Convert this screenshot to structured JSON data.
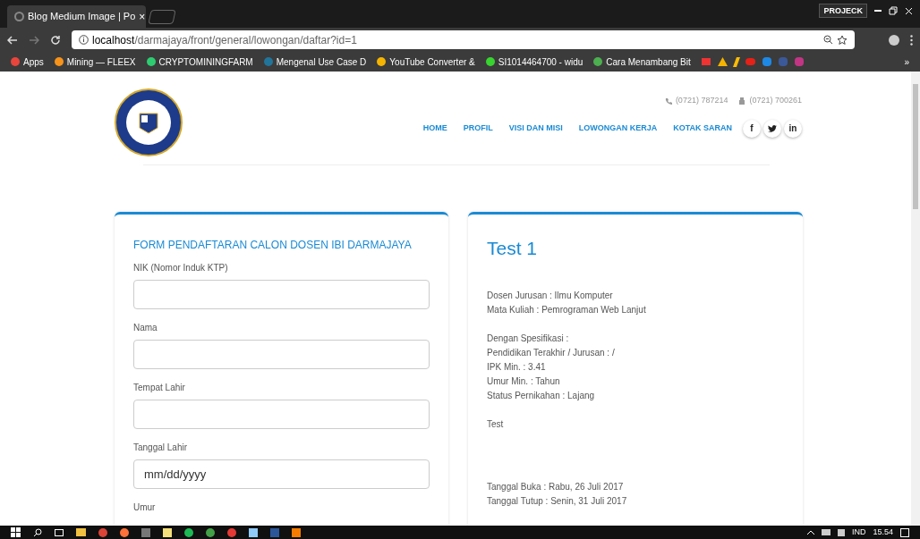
{
  "browser": {
    "tab": {
      "title": "Blog Medium Image | Po",
      "close": "×"
    },
    "profile": "PROJECK",
    "url": {
      "host": "localhost",
      "path": "/darmajaya/front/general/lowongan/daftar?id=1"
    },
    "bookmarks": [
      {
        "label": "Apps",
        "color": "#e8453c"
      },
      {
        "label": "Mining — FLEEX",
        "color": "#f7931a"
      },
      {
        "label": "CRYPTOMININGFARM",
        "color": "#2ecc71"
      },
      {
        "label": "Mengenal Use Case D",
        "color": "#21759b"
      },
      {
        "label": "YouTube Converter &",
        "color": "#f4b400"
      },
      {
        "label": "SI1014464700 - widu",
        "color": "#38d430"
      },
      {
        "label": "Cara Menambang Bit",
        "color": "#4caf50"
      }
    ],
    "more": "»"
  },
  "header": {
    "phones": [
      "(0721) 787214",
      "(0721) 700261"
    ],
    "nav": [
      {
        "label": "HOME"
      },
      {
        "label": "PROFIL"
      },
      {
        "label": "VISI DAN MISI"
      },
      {
        "label": "LOWONGAN KERJA"
      },
      {
        "label": "KOTAK SARAN"
      }
    ],
    "social": [
      {
        "kind": "text",
        "label": "f"
      },
      {
        "kind": "bird"
      },
      {
        "kind": "text",
        "label": "in"
      }
    ]
  },
  "form": {
    "title": "FORM PENDAFTARAN CALON DOSEN IBI DARMAJAYA",
    "fields": [
      {
        "kind": "input",
        "label": "NIK (Nomor Induk KTP)"
      },
      {
        "kind": "input",
        "label": "Nama"
      },
      {
        "kind": "input",
        "label": "Tempat Lahir"
      },
      {
        "kind": "input",
        "label": "Tanggal Lahir",
        "placeholder": "mm/dd/yyyy"
      },
      {
        "kind": "label",
        "label": "Umur"
      }
    ]
  },
  "job": {
    "title": "Test 1",
    "groups": [
      [
        "Dosen Jurusan : Ilmu Komputer",
        "Mata Kuliah : Pemrograman Web Lanjut"
      ],
      [
        "Dengan Spesifikasi :",
        "Pendidikan Terakhir / Jurusan : /",
        "IPK Min. : 3.41",
        "Umur Min. : Tahun",
        "Status Pernikahan : Lajang"
      ],
      [
        "Test"
      ],
      [
        "Tanggal Buka : Rabu, 26 Juli 2017",
        "Tanggal Tutup : Senin, 31 Juli 2017"
      ]
    ]
  },
  "taskbar": {
    "language": "IND",
    "time": "15.54"
  }
}
